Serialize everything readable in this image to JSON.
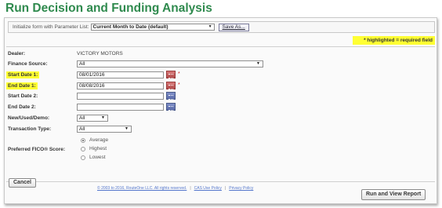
{
  "page": {
    "title": "Run Decision and Funding Analysis"
  },
  "parameters": {
    "label": "Initialize form with Parameter List:",
    "selected": "Current Month to Date (default)",
    "save_as_label": "Save As..."
  },
  "note": {
    "highlight_required": "* highlighted = required field"
  },
  "form": {
    "dealer": {
      "label": "Dealer:",
      "value": "VICTORY MOTORS"
    },
    "finance_source": {
      "label": "Finance Source:",
      "value": "All"
    },
    "start_date_1": {
      "label": "Start Date 1:",
      "value": "08/01/2016",
      "required_mark": "*"
    },
    "end_date_1": {
      "label": "End Date 1:",
      "value": "08/08/2016",
      "required_mark": "*"
    },
    "start_date_2": {
      "label": "Start Date 2:",
      "value": ""
    },
    "end_date_2": {
      "label": "End Date 2:",
      "value": ""
    },
    "new_used_demo": {
      "label": "New/Used/Demo:",
      "value": "All"
    },
    "transaction_type": {
      "label": "Transaction Type:",
      "value": "All"
    },
    "fico": {
      "label": "Preferred FICO® Score:",
      "options": [
        "Average",
        "Highest",
        "Lowest"
      ],
      "selected": "Average"
    }
  },
  "buttons": {
    "cancel": "Cancel",
    "run": "Run and View Report"
  },
  "footer": {
    "copyright": "© 2003 to 2016, RouteOne LLC. All rights reserved.",
    "sep": "|",
    "cas_policy": "CAS Use Policy",
    "privacy_policy": "Privacy Policy"
  },
  "icons": {
    "calendar": "calendar-icon",
    "dropdown": "chevron-down-icon"
  },
  "colors": {
    "title": "#2f8a4e",
    "highlight": "#ffff33",
    "required": "#d02020",
    "link": "#5577cc"
  }
}
